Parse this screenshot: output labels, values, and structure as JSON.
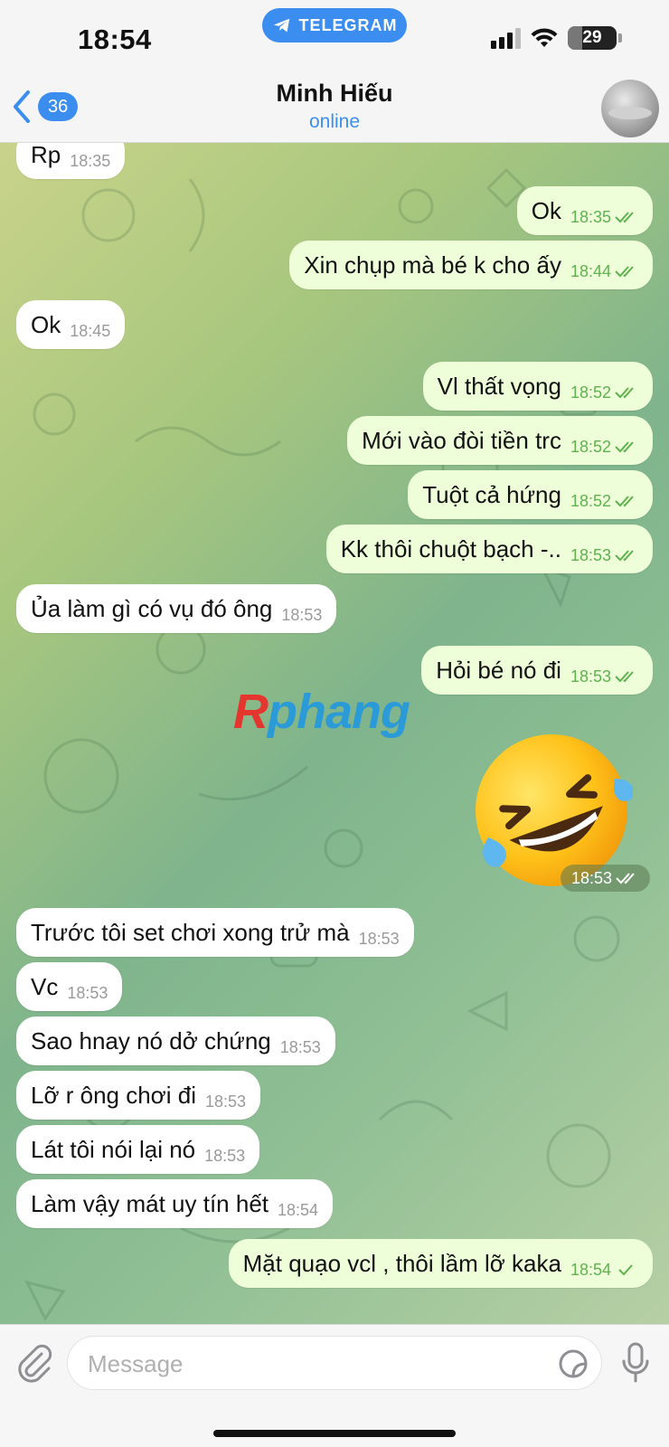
{
  "status_bar": {
    "time": "18:54",
    "app_pill": "TELEGRAM",
    "battery": "29",
    "battery_level": 0.29
  },
  "header": {
    "back_count": "36",
    "contact_name": "Minh Hiếu",
    "contact_status": "online"
  },
  "messages": [
    {
      "dir": "in",
      "text": "Rp",
      "time": "18:35"
    },
    {
      "dir": "out",
      "text": "Ok",
      "time": "18:35",
      "read": true
    },
    {
      "dir": "out",
      "text": "Xin chụp mà bé k cho ấy",
      "time": "18:44",
      "read": true
    },
    {
      "dir": "in",
      "text": "Ok",
      "time": "18:45"
    },
    {
      "dir": "out",
      "text": "Vl thất vọng",
      "time": "18:52",
      "read": true
    },
    {
      "dir": "out",
      "text": "Mới vào đòi tiền trc",
      "time": "18:52",
      "read": true
    },
    {
      "dir": "out",
      "text": "Tuột cả hứng",
      "time": "18:52",
      "read": true
    },
    {
      "dir": "out",
      "text": "Kk thôi chuột bạch -..",
      "time": "18:53",
      "read": true
    },
    {
      "dir": "in",
      "text": "Ủa làm gì có vụ đó ông",
      "time": "18:53"
    },
    {
      "dir": "out",
      "text": "Hỏi bé nó đi",
      "time": "18:53",
      "read": true
    },
    {
      "dir": "in",
      "text": "Trước tôi set chơi xong trử mà",
      "time": "18:53"
    },
    {
      "dir": "in",
      "text": "Vc",
      "time": "18:53"
    },
    {
      "dir": "in",
      "text": "Sao hnay nó dở chứng",
      "time": "18:53"
    },
    {
      "dir": "in",
      "text": "Lỡ r ông chơi đi",
      "time": "18:53"
    },
    {
      "dir": "in",
      "text": "Lát tôi nói lại nó",
      "time": "18:53"
    },
    {
      "dir": "in",
      "text": "Làm vậy mát uy tín hết",
      "time": "18:54"
    },
    {
      "dir": "out",
      "text": "Mặt quạo vcl , thôi lầm lỡ kaka",
      "time": "18:54",
      "read": false
    }
  ],
  "sticker_message": {
    "emoji": "rolling-on-the-floor-laughing",
    "time": "18:53"
  },
  "watermark": {
    "part1": "R",
    "part2": "phang"
  },
  "composer": {
    "placeholder": "Message"
  },
  "colors": {
    "accent": "#3b8ef0",
    "outgoing_bubble": "#eefed9",
    "incoming_bubble": "#ffffff",
    "check": "#5fb24f"
  }
}
